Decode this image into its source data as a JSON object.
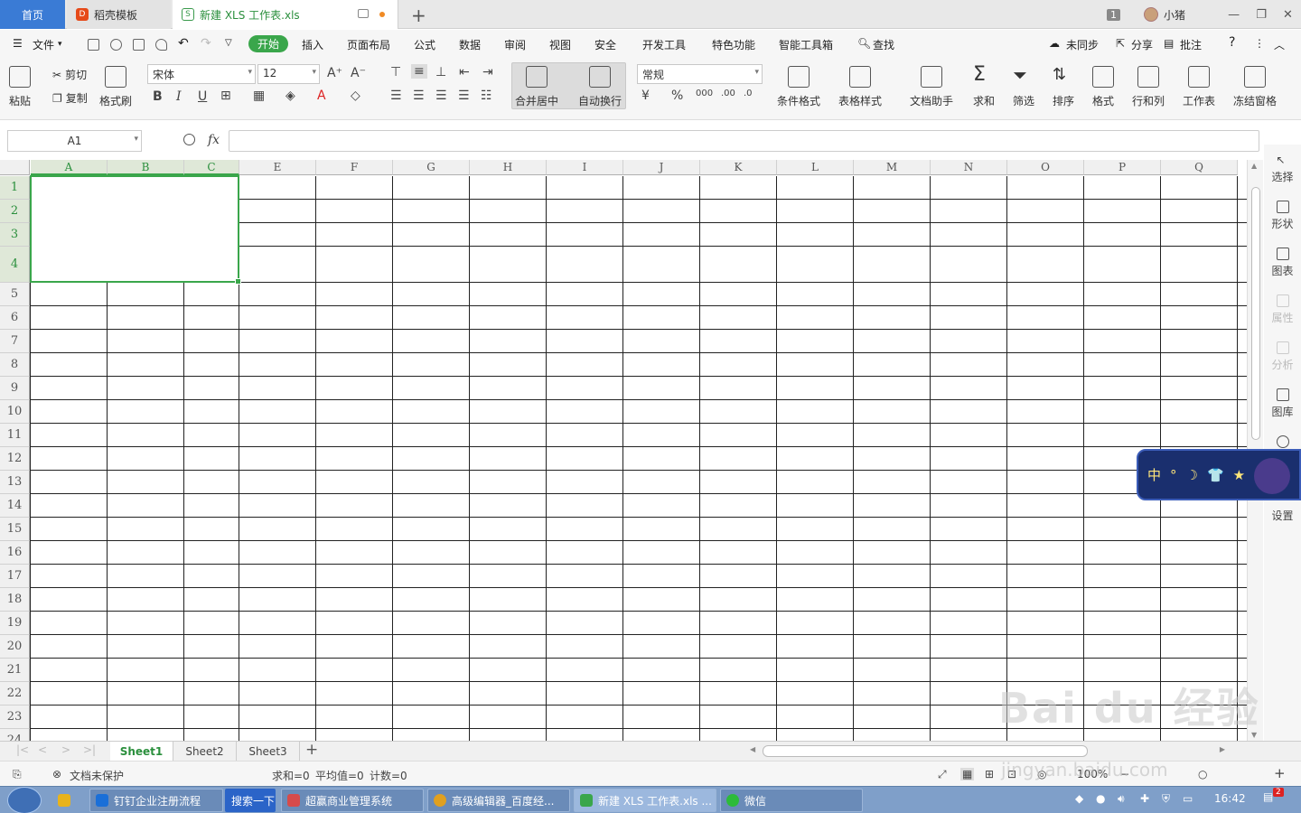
{
  "tabs": {
    "home": "首页",
    "docer": "稻壳模板",
    "active": "新建 XLS 工作表.xls",
    "badge": "1",
    "user": "小猪"
  },
  "menu": {
    "file": "文件",
    "items": [
      "开始",
      "插入",
      "页面布局",
      "公式",
      "数据",
      "审阅",
      "视图",
      "安全",
      "开发工具",
      "特色功能",
      "智能工具箱"
    ],
    "search": "查找",
    "sync": "未同步",
    "share": "分享",
    "comment": "批注",
    "help": "?"
  },
  "ribbon": {
    "paste": "粘贴",
    "cut": "剪切",
    "copy": "复制",
    "format_painter": "格式刷",
    "font_name": "宋体",
    "font_size": "12",
    "bold": "B",
    "italic": "I",
    "underline": "U",
    "merge_center": "合并居中",
    "auto_wrap": "自动换行",
    "number_format": "常规",
    "percent": "%",
    "cond_format": "条件格式",
    "table_style": "表格样式",
    "doc_helper": "文档助手",
    "sum": "求和",
    "filter": "筛选",
    "sort": "排序",
    "format": "格式",
    "row_col": "行和列",
    "worksheet": "工作表",
    "freeze": "冻结窗格"
  },
  "formula_bar": {
    "name_box": "A1",
    "fx": "fx",
    "value": ""
  },
  "grid": {
    "columns": [
      "A",
      "B",
      "C",
      "E",
      "F",
      "G",
      "H",
      "I",
      "J",
      "K",
      "L",
      "M",
      "N",
      "O",
      "P",
      "Q"
    ],
    "rows": [
      "1",
      "2",
      "3",
      "4",
      "5",
      "6",
      "7",
      "8",
      "9",
      "10",
      "11",
      "12",
      "13",
      "14",
      "15",
      "16",
      "17",
      "18",
      "19",
      "20",
      "21",
      "22",
      "23",
      "24"
    ]
  },
  "side_panel": [
    "选择",
    "形状",
    "图表",
    "属性",
    "分析",
    "图库",
    "设置"
  ],
  "ime": {
    "mode": "中",
    "symbols": [
      "°",
      "☽",
      "👕",
      "★"
    ]
  },
  "sheets": {
    "tabs": [
      "Sheet1",
      "Sheet2",
      "Sheet3"
    ],
    "add": "+"
  },
  "status": {
    "protect": "文档未保护",
    "sum": "求和=0",
    "avg": "平均值=0",
    "count": "计数=0",
    "zoom": "100%"
  },
  "taskbar": {
    "items": [
      "钉钉企业注册流程",
      "搜索一下",
      "超赢商业管理系统",
      "高级编辑器_百度经...",
      "新建 XLS 工作表.xls ...",
      "微信"
    ],
    "clock": "16:42",
    "notif": "2"
  },
  "watermark": {
    "logo": "Bai du 经验",
    "url": "jingyan.baidu.com"
  },
  "colors": {
    "accent_green": "#3aa64b",
    "tab_blue": "#3a7bd5",
    "taskbar": "#7f9fc9"
  }
}
